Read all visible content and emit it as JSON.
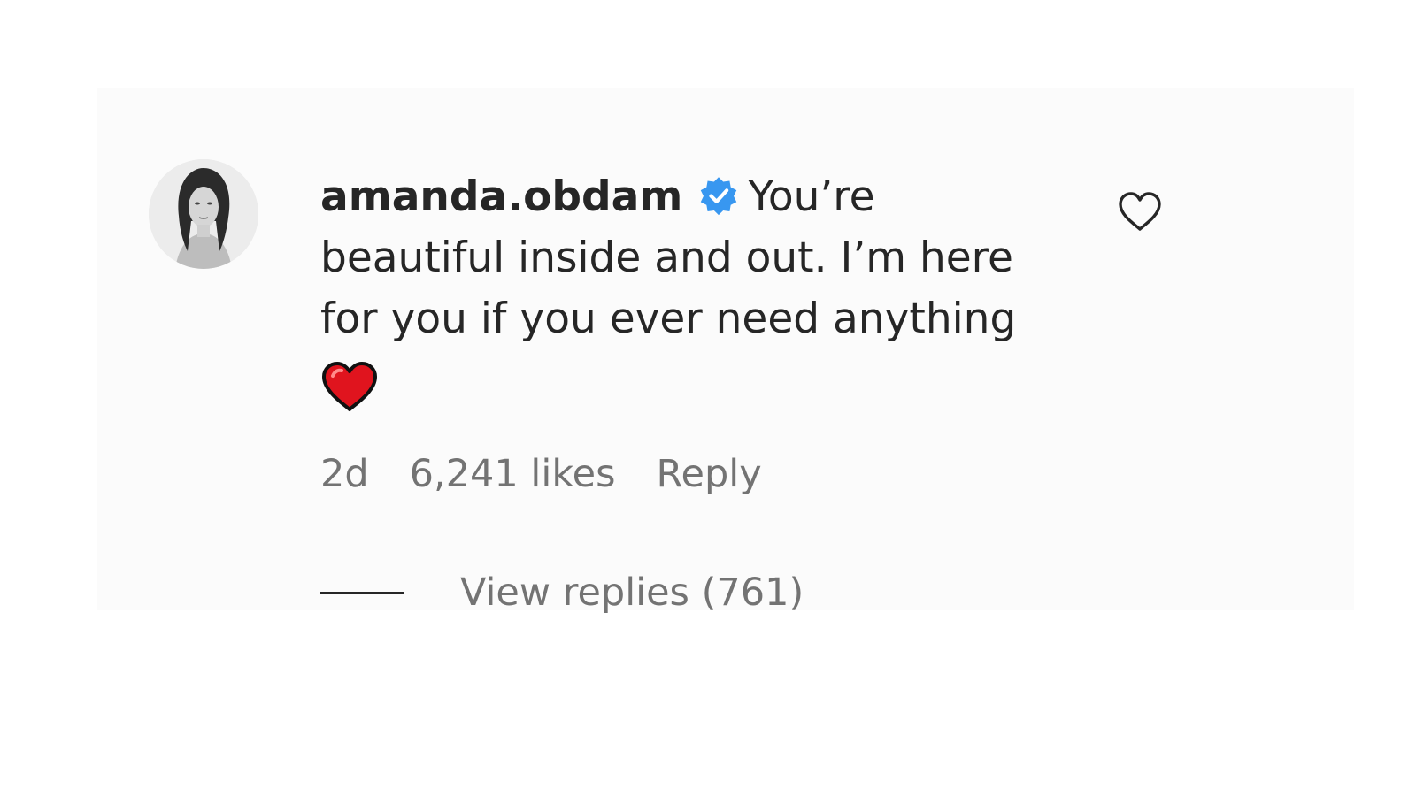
{
  "comment": {
    "username": "amanda.obdam",
    "verified": true,
    "verified_badge_color": "#3897f0",
    "text": "You’re beautiful inside and out. I’m here for you if you ever need anything",
    "emoji": "red-heart",
    "time_ago": "2d",
    "likes_label": "6,241 likes",
    "reply_label": "Reply",
    "view_replies_label": "View replies (761)"
  },
  "icons": {
    "like": "heart-outline-icon",
    "verified": "verified-badge-icon",
    "emoji": "red-heart-emoji"
  },
  "colors": {
    "text_primary": "#262626",
    "text_secondary": "#737373",
    "emoji_heart": "#e0141e"
  }
}
